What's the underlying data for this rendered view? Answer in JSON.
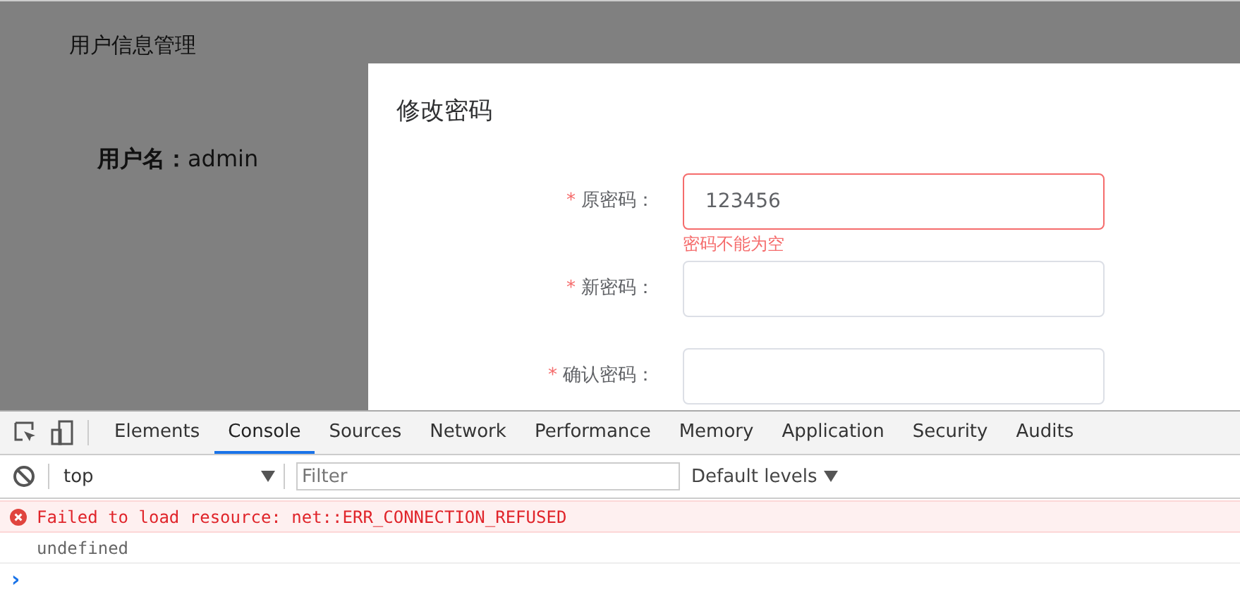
{
  "page": {
    "title": "用户信息管理",
    "username_label": "用户名：",
    "username": "admin"
  },
  "dialog": {
    "title": "修改密码",
    "fields": [
      {
        "required_mark": "*",
        "label": "原密码：",
        "value": "123456",
        "invalid": true,
        "error": "密码不能为空"
      },
      {
        "required_mark": "*",
        "label": "新密码：",
        "invalid": false
      },
      {
        "required_mark": "*",
        "label": "确认密码：",
        "invalid": false
      }
    ]
  },
  "devtools": {
    "tabs": [
      {
        "label": "Elements",
        "selected": false
      },
      {
        "label": "Console",
        "selected": true
      },
      {
        "label": "Sources",
        "selected": false
      },
      {
        "label": "Network",
        "selected": false
      },
      {
        "label": "Performance",
        "selected": false
      },
      {
        "label": "Memory",
        "selected": false
      },
      {
        "label": "Application",
        "selected": false
      },
      {
        "label": "Security",
        "selected": false
      },
      {
        "label": "Audits",
        "selected": false
      }
    ],
    "context": "top",
    "filter_placeholder": "Filter",
    "levels": "Default levels",
    "messages": [
      {
        "kind": "error",
        "text": "Failed to load resource: net::ERR_CONNECTION_REFUSED"
      },
      {
        "kind": "result",
        "text": "undefined"
      }
    ],
    "prompt": "›"
  }
}
